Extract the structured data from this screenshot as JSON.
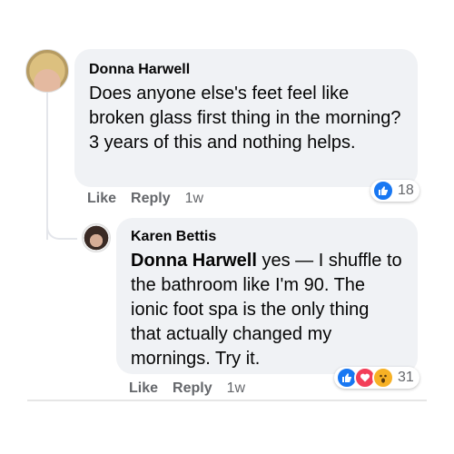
{
  "comment": {
    "author": "Donna Harwell",
    "text": "Does anyone else's feet feel like broken glass first thing in the morning? 3 years of this and nothing helps.",
    "actions": {
      "like": "Like",
      "reply": "Reply",
      "time": "1w"
    },
    "reactions": {
      "icons": [
        "like-icon"
      ],
      "count": "18"
    }
  },
  "reply": {
    "author": "Karen Bettis",
    "mention": "Donna Harwell",
    "text": " yes — I shuffle to the bathroom like I'm 90. The ionic foot spa is the only thing that actually changed my mornings. Try it.",
    "actions": {
      "like": "Like",
      "reply": "Reply",
      "time": "1w"
    },
    "reactions": {
      "icons": [
        "like-icon",
        "love-icon",
        "wow-icon"
      ],
      "count": "31"
    }
  },
  "colors": {
    "bubble": "#f0f2f5",
    "like": "#1877f2",
    "love": "#f33e58",
    "wow": "#f7b125",
    "meta": "#65676b"
  }
}
